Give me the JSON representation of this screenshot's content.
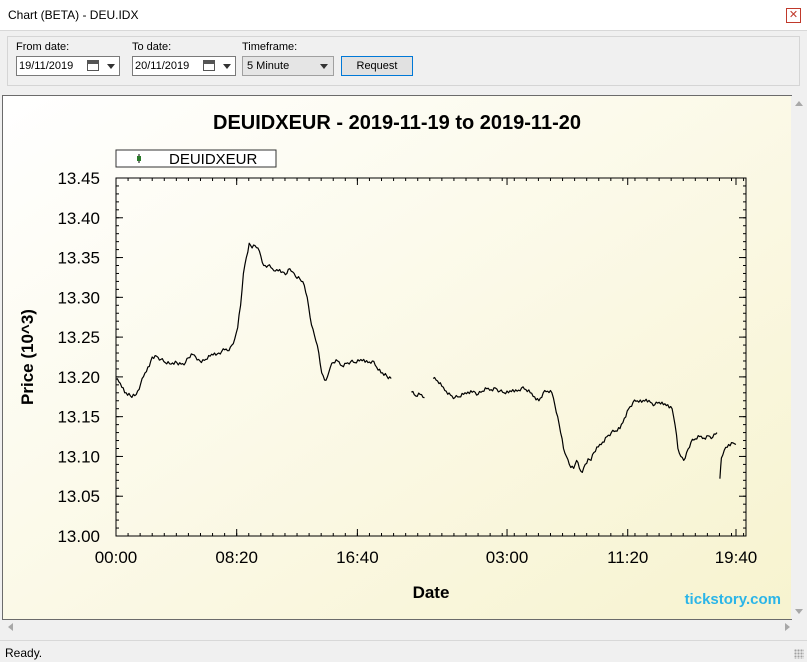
{
  "window": {
    "title": "Chart (BETA) - DEU.IDX",
    "close_glyph": "✕"
  },
  "toolbar": {
    "from_label": "From date:",
    "from_value": "19/11/2019",
    "to_label": "To date:",
    "to_value": "20/11/2019",
    "timeframe_label": "Timeframe:",
    "timeframe_value": "5 Minute",
    "request_label": "Request"
  },
  "status": {
    "text": "Ready."
  },
  "colors": {
    "chart_bg_from": "#ffffff",
    "chart_bg_to": "#f7f3cf",
    "series": "#000000",
    "legend_marker": "#2a7a2a",
    "watermark": "#2bb5e8"
  },
  "chart_data": {
    "type": "line",
    "title": "DEUIDXEUR - 2019-11-19 to 2019-11-20",
    "xlabel": "Date",
    "ylabel": "Price (10^3)",
    "ylim": [
      13.0,
      13.45
    ],
    "yticks": [
      "13.00",
      "13.05",
      "13.10",
      "13.15",
      "13.20",
      "13.25",
      "13.30",
      "13.35",
      "13.40",
      "13.45"
    ],
    "xtick_labels": [
      "00:00",
      "08:20",
      "16:40",
      "03:00",
      "11:20",
      "19:40"
    ],
    "xlim_hours": [
      0,
      43.5
    ],
    "xtick_hours": [
      0,
      8.333,
      16.667,
      27,
      35.333,
      43.667
    ],
    "legend": {
      "position": "top-left",
      "entries": [
        "DEUIDXEUR"
      ]
    },
    "watermark": "tickstory.com",
    "series": [
      {
        "name": "DEUIDXEUR",
        "note": "Time in hours from 2019-11-19 00:00; segments separated by market breaks",
        "segments": [
          [
            [
              0,
              13.197
            ],
            [
              0.3,
              13.192
            ],
            [
              0.6,
              13.18
            ],
            [
              1.0,
              13.176
            ],
            [
              1.4,
              13.178
            ],
            [
              1.7,
              13.191
            ],
            [
              2.0,
              13.205
            ],
            [
              2.3,
              13.213
            ],
            [
              2.5,
              13.225
            ],
            [
              2.8,
              13.226
            ],
            [
              3.1,
              13.222
            ],
            [
              3.4,
              13.218
            ],
            [
              3.8,
              13.216
            ],
            [
              4.2,
              13.218
            ],
            [
              4.5,
              13.216
            ],
            [
              4.8,
              13.218
            ],
            [
              5.0,
              13.224
            ],
            [
              5.3,
              13.228
            ],
            [
              5.5,
              13.225
            ],
            [
              5.7,
              13.222
            ],
            [
              5.9,
              13.218
            ],
            [
              6.2,
              13.222
            ],
            [
              6.5,
              13.226
            ],
            [
              6.8,
              13.23
            ],
            [
              7.0,
              13.229
            ],
            [
              7.3,
              13.232
            ],
            [
              7.6,
              13.235
            ],
            [
              7.8,
              13.233
            ],
            [
              8.0,
              13.24
            ],
            [
              8.2,
              13.248
            ],
            [
              8.4,
              13.262
            ],
            [
              8.6,
              13.29
            ],
            [
              8.8,
              13.33
            ],
            [
              9.0,
              13.35
            ],
            [
              9.2,
              13.368
            ],
            [
              9.4,
              13.362
            ],
            [
              9.6,
              13.365
            ],
            [
              9.8,
              13.362
            ],
            [
              10.0,
              13.352
            ],
            [
              10.2,
              13.34
            ],
            [
              10.5,
              13.34
            ],
            [
              10.8,
              13.336
            ],
            [
              11.0,
              13.333
            ],
            [
              11.3,
              13.335
            ],
            [
              11.5,
              13.332
            ],
            [
              11.8,
              13.33
            ],
            [
              12.0,
              13.336
            ],
            [
              12.2,
              13.332
            ],
            [
              12.4,
              13.326
            ],
            [
              12.6,
              13.326
            ],
            [
              12.8,
              13.32
            ],
            [
              13.0,
              13.315
            ],
            [
              13.2,
              13.3
            ],
            [
              13.4,
              13.275
            ],
            [
              13.6,
              13.26
            ],
            [
              13.8,
              13.245
            ],
            [
              14.0,
              13.23
            ],
            [
              14.2,
              13.205
            ],
            [
              14.4,
              13.196
            ],
            [
              14.6,
              13.2
            ],
            [
              14.8,
              13.212
            ],
            [
              15.0,
              13.218
            ],
            [
              15.3,
              13.22
            ],
            [
              15.6,
              13.214
            ],
            [
              15.9,
              13.217
            ],
            [
              16.2,
              13.219
            ],
            [
              16.5,
              13.218
            ],
            [
              16.8,
              13.22
            ],
            [
              17.1,
              13.222
            ],
            [
              17.4,
              13.218
            ],
            [
              17.7,
              13.22
            ],
            [
              18.0,
              13.212
            ],
            [
              18.3,
              13.205
            ],
            [
              18.7,
              13.201
            ],
            [
              19.0,
              13.198
            ]
          ],
          [
            [
              20.4,
              13.181
            ],
            [
              20.7,
              13.176
            ],
            [
              21.0,
              13.178
            ],
            [
              21.3,
              13.174
            ]
          ],
          [
            [
              21.9,
              13.198
            ],
            [
              22.2,
              13.195
            ],
            [
              22.5,
              13.188
            ],
            [
              22.8,
              13.182
            ],
            [
              23.1,
              13.177
            ],
            [
              23.4,
              13.174
            ],
            [
              23.7,
              13.175
            ],
            [
              24.0,
              13.178
            ],
            [
              24.3,
              13.181
            ],
            [
              24.7,
              13.182
            ],
            [
              25.0,
              13.178
            ],
            [
              25.3,
              13.182
            ],
            [
              25.6,
              13.185
            ],
            [
              25.9,
              13.184
            ],
            [
              26.2,
              13.186
            ],
            [
              26.5,
              13.182
            ],
            [
              26.8,
              13.18
            ],
            [
              27.1,
              13.18
            ],
            [
              27.4,
              13.184
            ],
            [
              27.7,
              13.182
            ],
            [
              28.0,
              13.186
            ],
            [
              28.3,
              13.184
            ],
            [
              28.6,
              13.18
            ],
            [
              28.9,
              13.175
            ],
            [
              29.2,
              13.17
            ],
            [
              29.5,
              13.18
            ],
            [
              29.8,
              13.182
            ],
            [
              30.1,
              13.18
            ],
            [
              30.3,
              13.165
            ],
            [
              30.5,
              13.15
            ],
            [
              30.7,
              13.13
            ],
            [
              30.9,
              13.11
            ],
            [
              31.1,
              13.1
            ],
            [
              31.3,
              13.09
            ],
            [
              31.6,
              13.085
            ],
            [
              31.8,
              13.095
            ],
            [
              32.0,
              13.085
            ],
            [
              32.2,
              13.08
            ],
            [
              32.4,
              13.09
            ],
            [
              32.6,
              13.097
            ],
            [
              32.8,
              13.095
            ],
            [
              33.0,
              13.105
            ],
            [
              33.3,
              13.112
            ],
            [
              33.6,
              13.118
            ],
            [
              33.9,
              13.125
            ],
            [
              34.2,
              13.13
            ],
            [
              34.5,
              13.132
            ],
            [
              34.8,
              13.135
            ],
            [
              35.1,
              13.148
            ],
            [
              35.4,
              13.16
            ],
            [
              35.7,
              13.168
            ],
            [
              36.0,
              13.17
            ],
            [
              36.3,
              13.168
            ],
            [
              36.6,
              13.172
            ],
            [
              36.9,
              13.168
            ],
            [
              37.2,
              13.165
            ],
            [
              37.5,
              13.168
            ],
            [
              37.8,
              13.165
            ],
            [
              38.1,
              13.165
            ],
            [
              38.4,
              13.16
            ],
            [
              38.6,
              13.14
            ],
            [
              38.8,
              13.11
            ],
            [
              39.0,
              13.1
            ],
            [
              39.2,
              13.095
            ],
            [
              39.4,
              13.105
            ],
            [
              39.7,
              13.118
            ],
            [
              40.0,
              13.122
            ],
            [
              40.3,
              13.125
            ],
            [
              40.6,
              13.123
            ],
            [
              40.9,
              13.126
            ],
            [
              41.2,
              13.124
            ],
            [
              41.5,
              13.13
            ]
          ],
          [
            [
              41.7,
              13.072
            ],
            [
              41.8,
              13.098
            ],
            [
              42.0,
              13.108
            ],
            [
              42.3,
              13.115
            ],
            [
              42.6,
              13.117
            ],
            [
              42.8,
              13.115
            ]
          ]
        ]
      }
    ]
  }
}
